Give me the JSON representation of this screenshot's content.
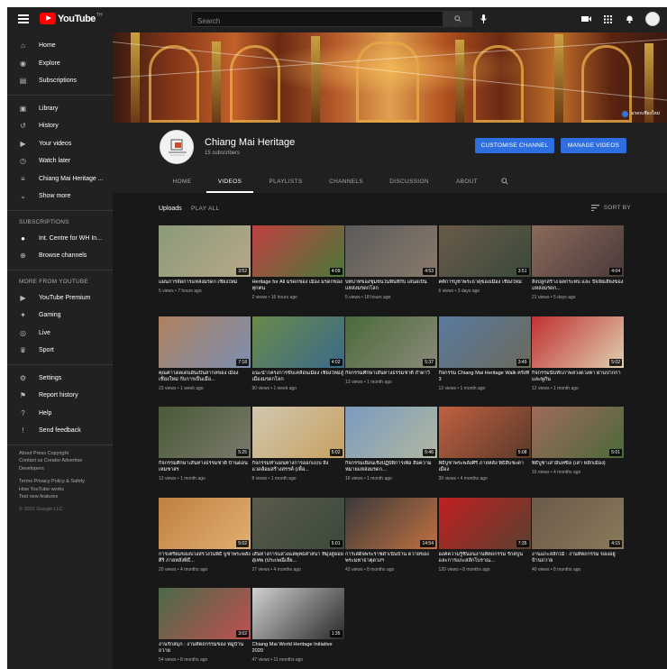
{
  "topbar": {
    "logo_text": "YouTube",
    "logo_country": "TH",
    "search_placeholder": "Search"
  },
  "sidebar": {
    "main": [
      {
        "label": "Home",
        "icon": "home-icon"
      },
      {
        "label": "Explore",
        "icon": "compass-icon"
      },
      {
        "label": "Subscriptions",
        "icon": "subscriptions-icon"
      }
    ],
    "library": [
      {
        "label": "Library",
        "icon": "library-icon"
      },
      {
        "label": "History",
        "icon": "history-icon"
      },
      {
        "label": "Your videos",
        "icon": "play-square-icon"
      },
      {
        "label": "Watch later",
        "icon": "clock-icon"
      },
      {
        "label": "Chiang Mai Heritage ...",
        "icon": "playlist-icon"
      },
      {
        "label": "Show more",
        "icon": "chevron-down-icon"
      }
    ],
    "subscriptions_heading": "SUBSCRIPTIONS",
    "subscriptions": [
      {
        "label": "Int. Centre for WH In...",
        "icon": "channel-avatar"
      },
      {
        "label": "Browse channels",
        "icon": "plus-circle-icon"
      }
    ],
    "more_heading": "MORE FROM YOUTUBE",
    "more": [
      {
        "label": "YouTube Premium",
        "icon": "youtube-premium-icon"
      },
      {
        "label": "Gaming",
        "icon": "gamepad-icon"
      },
      {
        "label": "Live",
        "icon": "live-icon"
      },
      {
        "label": "Sport",
        "icon": "trophy-icon"
      }
    ],
    "settings": [
      {
        "label": "Settings",
        "icon": "gear-icon"
      },
      {
        "label": "Report history",
        "icon": "flag-icon"
      },
      {
        "label": "Help",
        "icon": "help-icon"
      },
      {
        "label": "Send feedback",
        "icon": "feedback-icon"
      }
    ],
    "footer_line1": "About  Press  Copyright",
    "footer_line2": "Contact us  Creator  Advertise",
    "footer_line3": "Developers",
    "footer_line4": "Terms  Privacy  Policy & Safety",
    "footer_line5": "How YouTube works",
    "footer_line6": "Test new features",
    "copyright": "© 2021 Google LLC"
  },
  "banner": {
    "link_text": "มรดกเชียงใหม่"
  },
  "channel": {
    "name": "Chiang Mai Heritage",
    "subscribers": "15 subscribers",
    "customise_label": "CUSTOMISE CHANNEL",
    "manage_label": "MANAGE VIDEOS",
    "tabs": [
      "HOME",
      "VIDEOS",
      "PLAYLISTS",
      "CHANNELS",
      "DISCUSSION",
      "ABOUT"
    ],
    "active_tab": "VIDEOS"
  },
  "content": {
    "uploads_label": "Uploads",
    "play_all_label": "PLAY ALL",
    "sort_label": "SORT BY"
  },
  "videos": [
    {
      "title": "แผนการจัดการแหล่งมรดก เชียงใหม่",
      "meta": "5 views • 7 hours ago",
      "duration": "3:52",
      "c1": "#8a9a7a",
      "c2": "#b8a888"
    },
    {
      "title": "Heritage for All มรดกของ เมือง มรดกของทุกคน",
      "meta": "2 views • 16 hours ago",
      "duration": "4:09",
      "c1": "#c04040",
      "c2": "#4a7a3a"
    },
    {
      "title": "บทบาทของชุมชนในพื้นที่กับ เสนอเป็นแหล่งมรดกโลก",
      "meta": "5 views • 18 hours ago",
      "duration": "4:53",
      "c1": "#5a5a5a",
      "c2": "#8a7a6a"
    },
    {
      "title": "คติการบูชาพระธาตุของเมือง เชียงใหม่",
      "meta": "6 views • 3 days ago",
      "duration": "3:51",
      "c1": "#6a5a4a",
      "c2": "#3a4a3a"
    },
    {
      "title": "สิ่งปลูกสร้าง ผลกระทบ และ ปัจจัยเสี่ยงของแหล่งมรดก...",
      "meta": "21 views • 5 days ago",
      "duration": "4:04",
      "c1": "#8a6a5a",
      "c2": "#4a3a3a"
    },
    {
      "title": "คุณค่าโดดเด่นอันเป็นสากลของ เมืองเชียงใหม่ กับการเป็นเมือ...",
      "meta": "23 views • 1 week ago",
      "duration": "7:18",
      "c1": "#b08060",
      "c2": "#7a90b0"
    },
    {
      "title": "แนะนำโครงการขับเคลื่อนเมือง เชียงใหม่สู่เมืองมรดกโลก",
      "meta": "90 views • 1 week ago",
      "duration": "4:02",
      "c1": "#6a8a4a",
      "c2": "#3a6a8a"
    },
    {
      "title": "กิจกรรมศึกษาเส้นทางธรรมชาติ ถ้ำดาวี",
      "meta": "13 views • 1 month ago",
      "duration": "5:37",
      "c1": "#4a6a3a",
      "c2": "#8a8a7a"
    },
    {
      "title": "กิจกรรม Chiang Mai Heritage Walk ครั้งที่ 3",
      "meta": "12 views • 1 month ago",
      "duration": "3:45",
      "c1": "#5a7aa0",
      "c2": "#6a6a5a"
    },
    {
      "title": "กิจกรรมนับทักภาพล่วงดวงตา ผ่านปากกาและพู่กัน",
      "meta": "12 views • 1 month ago",
      "duration": "5:02",
      "c1": "#c03030",
      "c2": "#e0d0b0"
    },
    {
      "title": "กิจกรรมศึกษาเส้นทางธรรมชาติ บ้านดอนเหมชาสร",
      "meta": "13 views • 1 month ago",
      "duration": "5:25",
      "c1": "#4a5a3a",
      "c2": "#7a7a6a"
    },
    {
      "title": "กิจกรรมทำแผนทางการออกแบบ สิ่งแวดล้อมสร้างสรรค์ (เพื่อ...",
      "meta": "8 views • 1 month ago",
      "duration": "5:02",
      "c1": "#d0c8b0",
      "c2": "#c8a060"
    },
    {
      "title": "กิจกรรมเยือนเชิงปฏิบัติการเพื่อ สื่อความหมายแหล่งมรดก...",
      "meta": "16 views • 1 month ago",
      "duration": "5:46",
      "c1": "#7a9ac0",
      "c2": "#b0b8a0"
    },
    {
      "title": "พิธีบูชาพระพลังศิริ ภายหลัง พิธีสืบชะตาเมือง",
      "meta": "39 views • 4 months ago",
      "duration": "5:08",
      "c1": "#c06040",
      "c2": "#5a3a2a"
    },
    {
      "title": "พิธีบูชาเสาอินทขิล (เสา หลักเมือง)",
      "meta": "16 views • 4 months ago",
      "duration": "5:01",
      "c1": "#a06a5a",
      "c2": "#4a6a3a"
    },
    {
      "title": "การเตรียมของบวงสรวงในพิธี บูชาพระพลังศิริ ภายหลังพิธี...",
      "meta": "20 views • 4 months ago",
      "duration": "5:02",
      "c1": "#c08040",
      "c2": "#e0b070"
    },
    {
      "title": "เส้นทางการแสวงแลพุทธศาสนา ที่มุ่งสู่ดอยสุเทพ (ประเพณีเลีย...",
      "meta": "27 views • 4 months ago",
      "duration": "5:01",
      "c1": "#5a5a4a",
      "c2": "#3a4a3a"
    },
    {
      "title": "การเสด็จพระราชดำเนินบ้าน ดวายของพระมหาธาตุดวงฯ",
      "meta": "43 views • 8 months ago",
      "duration": "14:54",
      "c1": "#3a3a3a",
      "c2": "#c07040"
    },
    {
      "title": "องค์ความรู้ชิ้นอนงานหัตถกรรม รักสบูนและการแกะสลักโบราณ...",
      "meta": "120 views • 8 months ago",
      "duration": "7:35",
      "c1": "#c02020",
      "c2": "#5a4030"
    },
    {
      "title": "งานแกะสลักไม้ : งานหัตถกรรม ของอยู่บ้านถวาย",
      "meta": "40 views • 8 months ago",
      "duration": "4:15",
      "c1": "#6a5a4a",
      "c2": "#8a7a5a"
    },
    {
      "title": "งานรักสมุก : งานหัตถกรรมของ หมู่บ้านถวาย",
      "meta": "54 views • 8 months ago",
      "duration": "3:02",
      "c1": "#4a6a4a",
      "c2": "#c05050"
    },
    {
      "title": "Chiang Mai World Heritage Initiative 2020",
      "meta": "47 views • 11 months ago",
      "duration": "1:35",
      "c1": "#d0d0d0",
      "c2": "#2a2a2a"
    }
  ]
}
